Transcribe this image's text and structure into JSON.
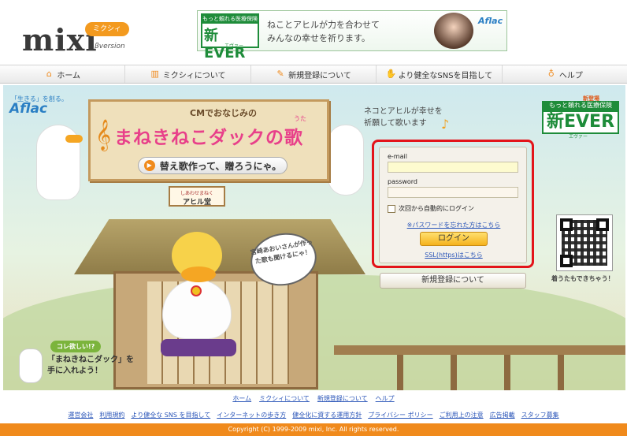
{
  "header": {
    "logo": "mixi",
    "logo_badge": "ミクシィ",
    "logo_beta": "βversion"
  },
  "banner": {
    "ever_top": "もっと頼れる医療保険",
    "ever_main": "新EVER",
    "ever_sub": "エヴァー",
    "line1": "ねことアヒルが力を合わせて",
    "line2": "みんなの幸せを祈ります。",
    "brand": "Aflac"
  },
  "nav": {
    "items": [
      {
        "label": "ホーム",
        "icon": "house-icon",
        "glyph": "⌂"
      },
      {
        "label": "ミクシィについて",
        "icon": "book-icon",
        "glyph": "▥"
      },
      {
        "label": "新規登録について",
        "icon": "pencil-icon",
        "glyph": "✎"
      },
      {
        "label": "より健全なSNSを目指して",
        "icon": "hands-icon",
        "glyph": "✋"
      },
      {
        "label": "ヘルプ",
        "icon": "lightbulb-icon",
        "glyph": "♁"
      }
    ]
  },
  "ad": {
    "aflac_small": "「生きる」を創る。",
    "aflac_big": "Aflac",
    "cm_text": "CMでおなじみの",
    "song_title": "まねきねこダックの歌",
    "uta_ruby": "うた",
    "sub_button": "替え歌作って、贈ろうにゃ。",
    "neko_line1": "ネコとアヒルが幸せを",
    "neko_line2": "祈願して歌います",
    "ever_new": "新登場",
    "ever_tag": "もっと頼れる医療保険",
    "ever_big": "新EVER",
    "ever_kana": "エヴァー",
    "sign_top": "しあわせまねく",
    "sign_main": "アヒル堂",
    "speech": "宮崎あおいさんが作った歌も聞けるにゃ！",
    "kiuta": "着うたもできちゃう！",
    "promo_bubble": "コレ欲しい!?",
    "promo_line1": "「まねきねこダック」を",
    "promo_line2": "手に入れよう！"
  },
  "login": {
    "email_label": "e-mail",
    "email_value": "",
    "password_label": "password",
    "password_value": "",
    "auto_login": "次回から自動的にログイン",
    "forgot": "※パスワードを忘れた方はこちら",
    "login_button": "ログイン",
    "ssl": "SSL(https)はこちら",
    "register_button": "新規登録について"
  },
  "footer": {
    "links1": [
      "ホーム",
      "ミクシィについて",
      "新規登録について",
      "ヘルプ"
    ],
    "links2": [
      "運営会社",
      "利用規約",
      "より健全な SNS を目指して",
      "インターネットの歩き方",
      "健全化に資する運用方針",
      "プライバシー ポリシー",
      "ご利用上の注意",
      "広告掲載",
      "スタッフ募集"
    ],
    "copyright": "Copyright (C) 1999-2009 mixi, Inc. All rights reserved."
  },
  "colors": {
    "accent": "#f08a1c",
    "link": "#2a55b8",
    "highlight_outline": "#e3141a",
    "ever_green": "#1e8c3a"
  }
}
